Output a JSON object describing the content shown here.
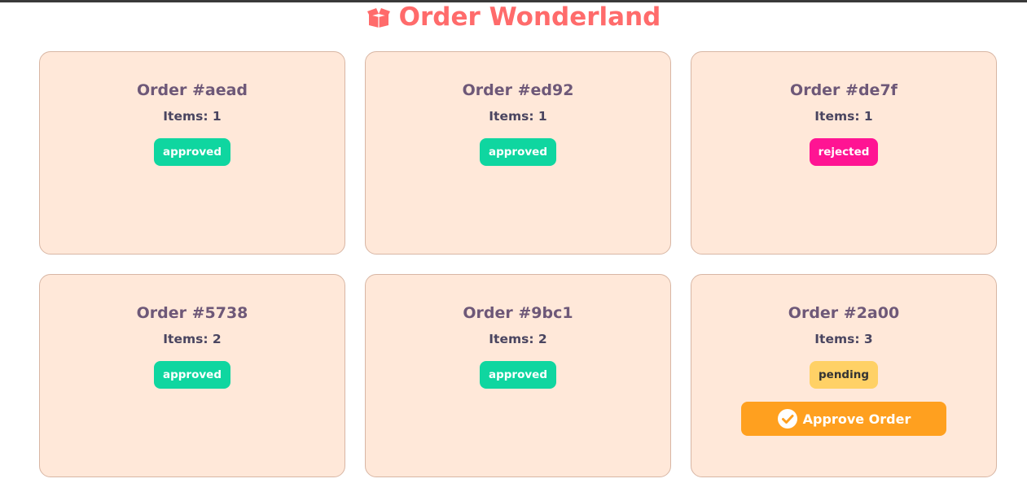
{
  "page": {
    "title": "Order Wonderland",
    "title_icon": "box-open-icon",
    "title_color": "#ff6b6b",
    "card_bg": "#ffe8d9"
  },
  "orders": [
    {
      "title": "Order #aead",
      "items": "Items: 1",
      "status": "approved"
    },
    {
      "title": "Order #ed92",
      "items": "Items: 1",
      "status": "approved"
    },
    {
      "title": "Order #de7f",
      "items": "Items: 1",
      "status": "rejected"
    },
    {
      "title": "Order #5738",
      "items": "Items: 2",
      "status": "approved"
    },
    {
      "title": "Order #9bc1",
      "items": "Items: 2",
      "status": "approved"
    },
    {
      "title": "Order #2a00",
      "items": "Items: 3",
      "status": "pending",
      "action_label": "Approve Order",
      "action_icon": "check-circle-icon"
    }
  ],
  "status_colors": {
    "approved": "#0fd6a0",
    "rejected": "#ff1493",
    "pending": "#ffd166"
  }
}
